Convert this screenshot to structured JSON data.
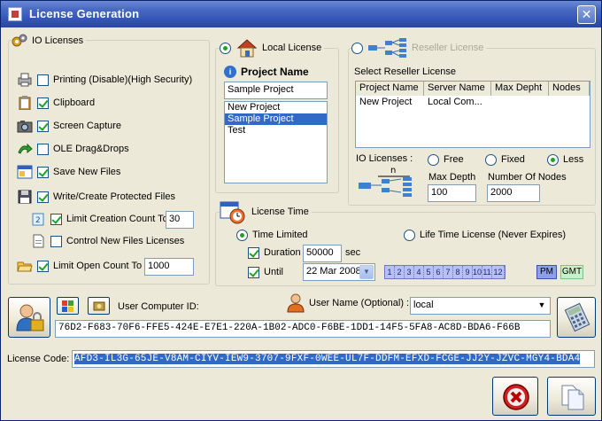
{
  "window": {
    "title": "License Generation",
    "close_glyph": "✕"
  },
  "io_licenses": {
    "title": "IO Licenses",
    "items": [
      {
        "label": "Printing (Disable)(High Security)",
        "checked": false,
        "icon": "printer-icon"
      },
      {
        "label": "Clipboard",
        "checked": true,
        "icon": "clipboard-icon"
      },
      {
        "label": "Screen Capture",
        "checked": true,
        "icon": "camera-icon"
      },
      {
        "label": "OLE Drag&Drops",
        "checked": false,
        "icon": "drag-drop-icon"
      },
      {
        "label": "Save New Files",
        "checked": true,
        "icon": "save-window-icon"
      },
      {
        "label": "Write/Create Protected Files",
        "checked": true,
        "icon": "floppy-icon"
      }
    ],
    "limit_creation": {
      "label": "Limit Creation Count To",
      "checked": true,
      "value": "30"
    },
    "control_new": {
      "label": "Control New Files Licenses",
      "checked": false
    },
    "limit_open": {
      "label": "Limit Open Count To",
      "checked": true,
      "value": "1000"
    }
  },
  "local_license": {
    "title": "Local License",
    "selected": true,
    "project_name_label": "Project Name",
    "project_name_value": "Sample Project",
    "projects": [
      "New Project",
      "Sample Project",
      "Test"
    ],
    "selected_project": 1
  },
  "reseller_license": {
    "title": "Reseller License",
    "selected": false,
    "select_label": "Select Reseller License",
    "columns": [
      "Project Name",
      "Server Name",
      "Max Depht",
      "Nodes"
    ],
    "rows": [
      [
        "New Project",
        "Local Com...",
        "",
        ""
      ]
    ],
    "io_licenses_label": "IO Licenses :",
    "io_options": [
      "Free",
      "Fixed",
      "Less"
    ],
    "io_selected": 2,
    "tree_label": "n",
    "max_depth_label": "Max Depth",
    "max_depth_value": "100",
    "nodes_label": "Number Of Nodes",
    "nodes_value": "2000"
  },
  "license_time": {
    "title": "License Time",
    "time_limited": "Time Limited",
    "lifetime": "Life Time License (Never Expires)",
    "time_limited_selected": true,
    "duration_label": "Duration",
    "duration_checked": true,
    "duration_value": "50000",
    "duration_unit": "sec",
    "until_label": "Until",
    "until_checked": true,
    "until_value": "22 Mar 2008",
    "hours": [
      "1",
      "2",
      "3",
      "4",
      "5",
      "6",
      "7",
      "8",
      "9",
      "10",
      "11",
      "12"
    ],
    "pm_label": "PM",
    "gmt_label": "GMT"
  },
  "computer": {
    "user_id_label": "User Computer ID:",
    "user_name_label": "User Name (Optional) :",
    "user_name_value": "local",
    "computer_id": "76D2-F683-70F6-FFE5-424E-E7E1-220A-1B02-ADC0-F6BE-1DD1-14F5-5FA8-AC8D-BDA6-F66B"
  },
  "license_code": {
    "label": "License Code:",
    "value": "AFD3-IL3G-65JE-V8AM-CIYV-IEW9-3707-9FXF-0WEE-UL7F-DDFM-EFXD-FCGE-JJ2Y-JZVC-MGY4-BDA4"
  },
  "colors": {
    "title_bar": "#3355b5",
    "selection": "#316ac5",
    "check": "#21a121"
  }
}
